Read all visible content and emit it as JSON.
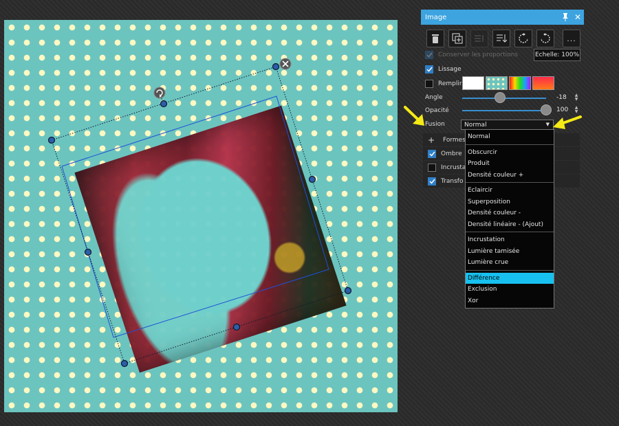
{
  "panel": {
    "title": "Image",
    "pin_icon": "pin-icon",
    "close_icon": "close-icon",
    "toolbar": [
      {
        "name": "delete-button",
        "icon": "trash-icon"
      },
      {
        "name": "duplicate-button",
        "icon": "duplicate-icon"
      },
      {
        "name": "align-button",
        "icon": "align-icon",
        "disabled": true
      },
      {
        "name": "order-button",
        "icon": "order-down-icon"
      },
      {
        "name": "rotate-left-button",
        "icon": "rotate-ccw-icon"
      },
      {
        "name": "rotate-right-button",
        "icon": "rotate-cw-icon"
      }
    ],
    "more_label": "...",
    "keep_ratio": {
      "label": "Conserver les proportions",
      "checked": true,
      "disabled": true
    },
    "scale_label": "Echelle: 100%",
    "smoothing": {
      "label": "Lissage",
      "checked": true
    },
    "fill": {
      "label": "Remplir",
      "checked": false,
      "swatches": [
        "white",
        "dots",
        "rainbow",
        "red-orange"
      ]
    },
    "angle": {
      "label": "Angle",
      "value": "-18",
      "percent": 0.45
    },
    "opacity": {
      "label": "Opacité",
      "value": "100",
      "percent": 1.0
    },
    "blend": {
      "label": "Fusion",
      "selected": "Normal"
    },
    "sections": [
      {
        "label": "Formes",
        "type": "plus"
      },
      {
        "label": "Ombre",
        "checked": true
      },
      {
        "label": "Incrusta",
        "checked": false
      },
      {
        "label": "Transfo",
        "checked": true
      }
    ]
  },
  "dropdown": {
    "groups": [
      [
        "Normal"
      ],
      [
        "Obscurcir",
        "Produit",
        "Densité couleur +"
      ],
      [
        "Eclaircir",
        "Superposition",
        "Densité couleur -",
        "Densité linéaire - (Ajout)"
      ],
      [
        "Incrustation",
        "Lumière tamisée",
        "Lumière crue"
      ],
      [
        "Différence",
        "Exclusion",
        "Xor"
      ]
    ],
    "highlighted": "Différence"
  },
  "colors": {
    "accent": "#3da4e0",
    "highlight": "#17c0ef",
    "canvas_bg": "#6cc4bf",
    "dots": "#fff8c2",
    "arrow": "#f5ea16"
  }
}
